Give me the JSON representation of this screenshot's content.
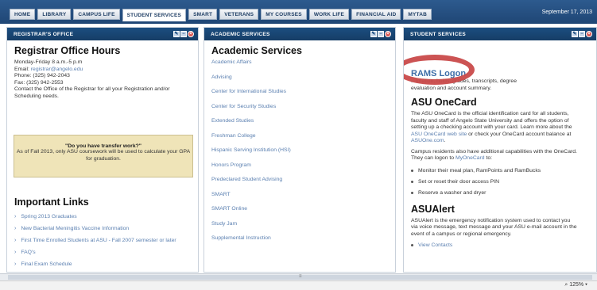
{
  "nav": {
    "tabs": [
      "HOME",
      "LIBRARY",
      "CAMPUS LIFE",
      "STUDENT SERVICES",
      "SMART",
      "VETERANS",
      "MY COURSES",
      "WORK LIFE",
      "FINANCIAL AID",
      "MYTAB"
    ],
    "active_tab": "STUDENT SERVICES",
    "date": "September 17, 2013"
  },
  "registrar": {
    "header": "REGISTRAR'S OFFICE",
    "title": "Registrar Office Hours",
    "hours": "Monday-Friday 8 a.m.-5 p.m",
    "email_label": "Email:",
    "email": "registrar@angelo.edu",
    "phone": "Phone: (325) 942-2043",
    "fax": "Fax: (325) 942-2553",
    "contact": "Contact the Office of the Registrar for all your Registration and/or Scheduling needs.",
    "transfer_title": "\"Do you have transfer work?\"",
    "transfer_text": "As of Fall 2013, only ASU coursework will be used to calculate your GPA for graduation.",
    "links_title": "Important Links",
    "links": [
      "Spring 2013 Graduates",
      "New Bacterial Meningitis Vaccine Information",
      "First Time Enrolled Students at ASU - Fall 2007 semester or later",
      "FAQ's",
      "Final Exam Schedule"
    ]
  },
  "academic": {
    "header": "ACADEMIC SERVICES",
    "title": "Academic Services",
    "items": [
      "Academic Affairs",
      "Advising",
      "Center for International Studies",
      "Center for Security Studies",
      "Extended Studies",
      "Freshman College",
      "Hispanic Serving Institution (HSI)",
      "Honors Program",
      "Predeclared Student Advising",
      "SMART",
      "SMART Online",
      "Study Jam",
      "Supplemental Instruction"
    ]
  },
  "student": {
    "header": "STUDENT SERVICES",
    "rams_title": "RAMS Logon",
    "rams_text_1": "...rmation, holds, grades, transcripts, degree",
    "rams_text_2": "evaluation and account summary.",
    "onecard_title": "ASU OneCard",
    "onecard_p1a": "The ASU OneCard is the official identification card for all students,",
    "onecard_p1b": "faculty and staff of Angelo State University and offers the option of",
    "onecard_p1c": "setting up a checking account with your card. Learn more about the",
    "onecard_link1": "ASU OneCard web site",
    "onecard_p1d": "or check your OneCard account balance at",
    "onecard_link2": "ASUOne.com",
    "onecard_p2a": "Campus residents also have additional capabilities with the OneCard.",
    "onecard_p2b": "They can logon to",
    "onecard_link3": "MyOneCard",
    "onecard_p2c": "to:",
    "bullets": [
      "Monitor their meal plan, RamPoints and RamBucks",
      "Set or reset their door access PIN",
      "Reserve a washer and dryer"
    ],
    "alert_title": "ASUAlert",
    "alert_p1": "ASUAlert is the emergency notification system used to contact you",
    "alert_p2": "via voice message, text message and your ASU e-mail account in the",
    "alert_p3": "event of a campus or regional emergency.",
    "view_contacts": "View Contacts"
  },
  "status": {
    "zoom": "125%"
  }
}
